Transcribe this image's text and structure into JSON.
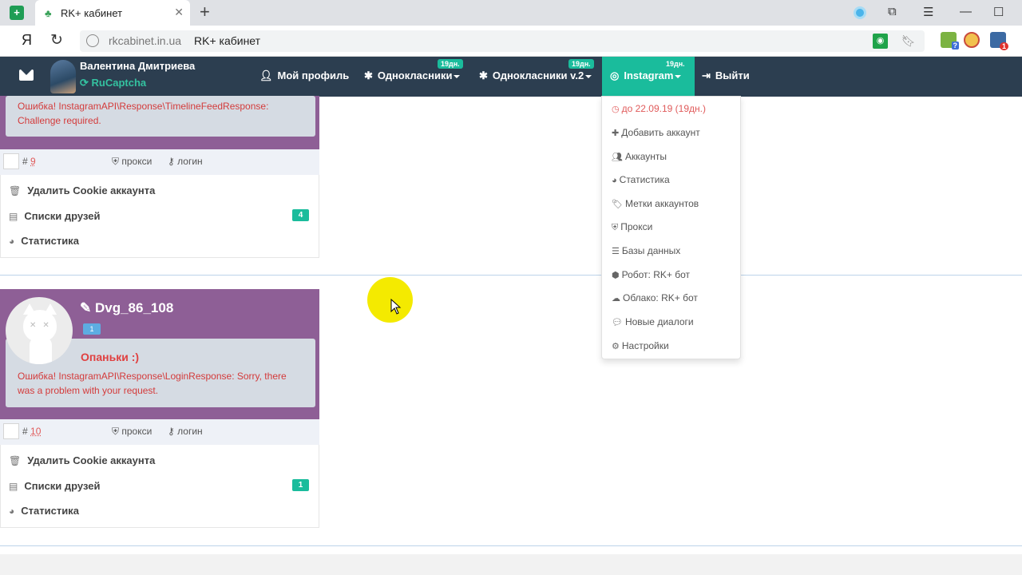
{
  "browser": {
    "tab_title": "RK+ кабинет",
    "address_host": "rkcabinet.in.ua",
    "address_title": "RK+ кабинет",
    "yandex_label": "Я",
    "ext_badge_1": "?",
    "ext_badge_3": "1"
  },
  "nav": {
    "user_name": "Валентина Дмитриева",
    "captcha": "RuCaptcha",
    "profile": "Мой профиль",
    "ok": "Однокласники",
    "ok_badge": "19дн.",
    "ok2": "Однокласники v.2",
    "ok2_badge": "19дн.",
    "instagram": "Instagram",
    "instagram_badge": "19дн.",
    "logout": "Выйти"
  },
  "dropdown": {
    "expire": "до 22.09.19 (19дн.)",
    "items": [
      "Добавить аккаунт",
      "Аккаунты",
      "Статистика",
      "Метки аккаунтов",
      "Прокси",
      "Базы данных",
      "Робот: RK+ бот",
      "Облако: RK+ бот",
      "Новые диалоги",
      "Настройки"
    ]
  },
  "cards": [
    {
      "error": "Ошибка! InstagramAPI\\Response\\TimelineFeedResponse: Challenge required.",
      "number": "9",
      "proxy": "прокси",
      "login": "логин",
      "delete_cookie": "Удалить Cookie аккаунта",
      "friends": "Списки друзей",
      "friends_count": "4",
      "stats": "Статистика"
    },
    {
      "name": "Dvg_86_108",
      "tag": "1",
      "oops": "Опаньки :)",
      "error": "Ошибка! InstagramAPI\\Response\\LoginResponse: Sorry, there was a problem with your request.",
      "number": "10",
      "proxy": "прокси",
      "login": "логин",
      "delete_cookie": "Удалить Cookie аккаунта",
      "friends": "Списки друзей",
      "friends_count": "1",
      "stats": "Статистика"
    }
  ],
  "colors": {
    "nav_bg": "#2c3e50",
    "accent": "#1abc9c",
    "card_purple": "#8e5f96",
    "error_red": "#d43b3b"
  }
}
